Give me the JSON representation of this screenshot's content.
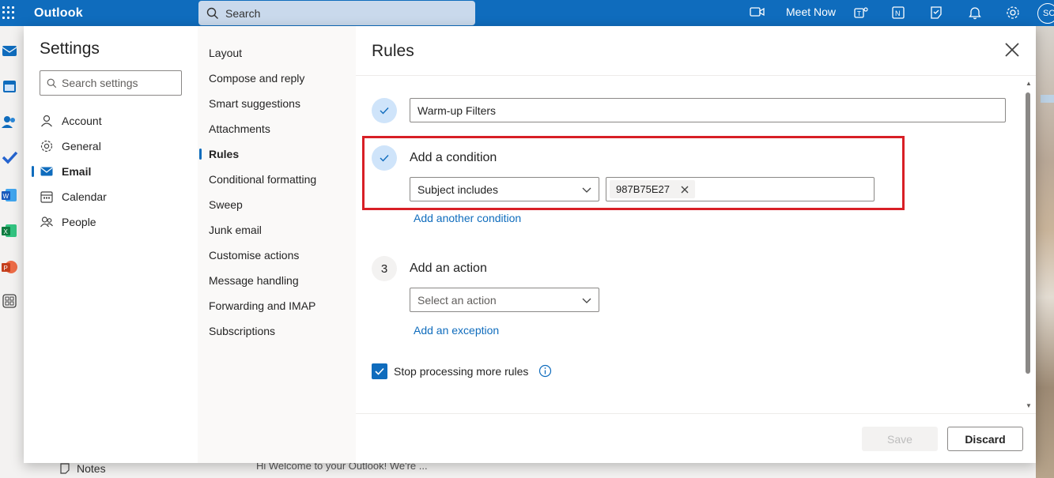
{
  "app": {
    "title": "Outlook",
    "search_placeholder": "Search",
    "meet_now_label": "Meet Now",
    "avatar_initials": "SC",
    "accent_color": "#0f6cbd"
  },
  "background": {
    "notes_label": "Notes",
    "welcome_preview": "Hi Welcome to your Outlook! We're ..."
  },
  "settings": {
    "title": "Settings",
    "search_placeholder": "Search settings",
    "categories": [
      {
        "label": "Account",
        "icon": "person-icon"
      },
      {
        "label": "General",
        "icon": "gear-icon"
      },
      {
        "label": "Email",
        "icon": "mail-icon",
        "active": true
      },
      {
        "label": "Calendar",
        "icon": "calendar-icon"
      },
      {
        "label": "People",
        "icon": "people-icon"
      }
    ],
    "email_sections": [
      "Layout",
      "Compose and reply",
      "Smart suggestions",
      "Attachments",
      "Rules",
      "Conditional formatting",
      "Sweep",
      "Junk email",
      "Customise actions",
      "Message handling",
      "Forwarding and IMAP",
      "Subscriptions"
    ],
    "active_section": "Rules"
  },
  "rules": {
    "title": "Rules",
    "rule_name": "Warm-up Filters",
    "condition": {
      "heading": "Add a condition",
      "type": "Subject includes",
      "values": [
        "987B75E27"
      ],
      "add_another_link": "Add another condition"
    },
    "action": {
      "step_number": "3",
      "heading": "Add an action",
      "placeholder": "Select an action",
      "add_exception_link": "Add an exception"
    },
    "stop_processing": {
      "label": "Stop processing more rules",
      "checked": true
    },
    "save_label": "Save",
    "discard_label": "Discard",
    "highlight_color": "#d81f26"
  }
}
